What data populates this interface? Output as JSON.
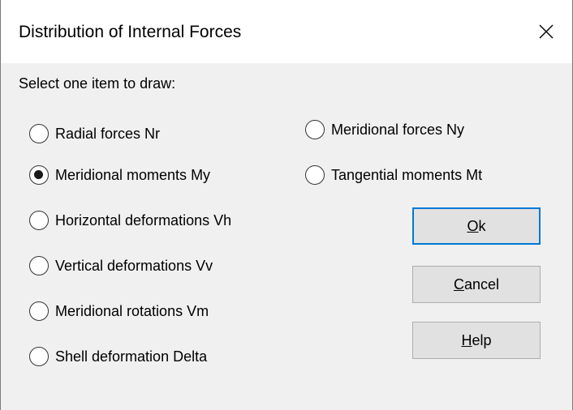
{
  "dialog": {
    "title": "Distribution of Internal Forces",
    "prompt": "Select one item to draw:"
  },
  "options": [
    {
      "label": "Radial forces Nr",
      "checked": false
    },
    {
      "label": "Meridional moments My",
      "checked": true
    },
    {
      "label": "Horizontal deformations Vh",
      "checked": false
    },
    {
      "label": "Vertical deformations Vv",
      "checked": false
    },
    {
      "label": "Meridional rotations Vm",
      "checked": false
    },
    {
      "label": "Shell deformation Delta",
      "checked": false
    },
    {
      "label": "Meridional forces Ny",
      "checked": false
    },
    {
      "label": "Tangential moments Mt",
      "checked": false
    }
  ],
  "buttons": {
    "ok": {
      "accel": "O",
      "rest": "k"
    },
    "cancel": {
      "accel": "C",
      "rest": "ancel"
    },
    "help": {
      "accel": "H",
      "rest": "elp"
    }
  },
  "icons": {
    "close": "close-icon"
  },
  "colors": {
    "focus_border": "#0078d7",
    "dialog_bg": "#f0f0f0"
  }
}
